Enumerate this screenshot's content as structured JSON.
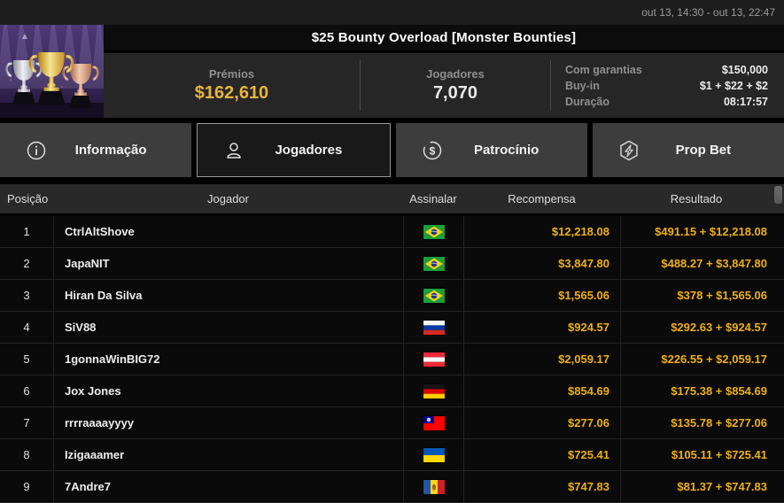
{
  "top_bar": {
    "schedule": "out 13, 14:30 - out 13, 22:47"
  },
  "header": {
    "title": "$25 Bounty Overload [Monster Bounties]",
    "art": "three-trophies-purple",
    "stats": {
      "prizes_label": "Prémios",
      "prizes_value": "$162,610",
      "players_label": "Jogadores",
      "players_value": "7,070"
    },
    "details": [
      {
        "label": "Com garantias",
        "value": "$150,000"
      },
      {
        "label": "Buy-in",
        "value": "$1 + $22 + $2"
      },
      {
        "label": "Duração",
        "value": "08:17:57"
      }
    ]
  },
  "tabs": [
    {
      "label": "Informação",
      "icon": "info-icon",
      "active": false
    },
    {
      "label": "Jogadores",
      "icon": "person-icon",
      "active": true
    },
    {
      "label": "Patrocínio",
      "icon": "dollar-circle-icon",
      "active": false
    },
    {
      "label": "Prop Bet",
      "icon": "prop-bet-icon",
      "active": false
    }
  ],
  "table": {
    "columns": {
      "position": "Posição",
      "player": "Jogador",
      "flag": "Assinalar",
      "reward": "Recompensa",
      "result": "Resultado"
    },
    "rows": [
      {
        "position": "1",
        "player": "CtrlAltShove",
        "flag": "brazil",
        "reward": "$12,218.08",
        "result": "$491.15 + $12,218.08"
      },
      {
        "position": "2",
        "player": "JapaNIT",
        "flag": "brazil",
        "reward": "$3,847.80",
        "result": "$488.27 + $3,847.80"
      },
      {
        "position": "3",
        "player": "Hiran Da Silva",
        "flag": "brazil",
        "reward": "$1,565.06",
        "result": "$378 + $1,565.06"
      },
      {
        "position": "4",
        "player": "SiV88",
        "flag": "russia",
        "reward": "$924.57",
        "result": "$292.63 + $924.57"
      },
      {
        "position": "5",
        "player": "1gonnaWinBIG72",
        "flag": "austria",
        "reward": "$2,059.17",
        "result": "$226.55 + $2,059.17"
      },
      {
        "position": "6",
        "player": "Jox Jones",
        "flag": "germany",
        "reward": "$854.69",
        "result": "$175.38 + $854.69"
      },
      {
        "position": "7",
        "player": "rrrraaaayyyy",
        "flag": "taiwan",
        "reward": "$277.06",
        "result": "$135.78 + $277.06"
      },
      {
        "position": "8",
        "player": "Izigaaamer",
        "flag": "ukraine",
        "reward": "$725.41",
        "result": "$105.11 + $725.41"
      },
      {
        "position": "9",
        "player": "7Andre7",
        "flag": "moldova",
        "reward": "$747.83",
        "result": "$81.37 + $747.83"
      }
    ]
  },
  "colors": {
    "accent_gold": "#eeb014",
    "prize_gold": "#e9b43c",
    "panel_gray": "#262626",
    "tab_gray": "#3d3d3d",
    "row_black": "#0a0a0a"
  }
}
